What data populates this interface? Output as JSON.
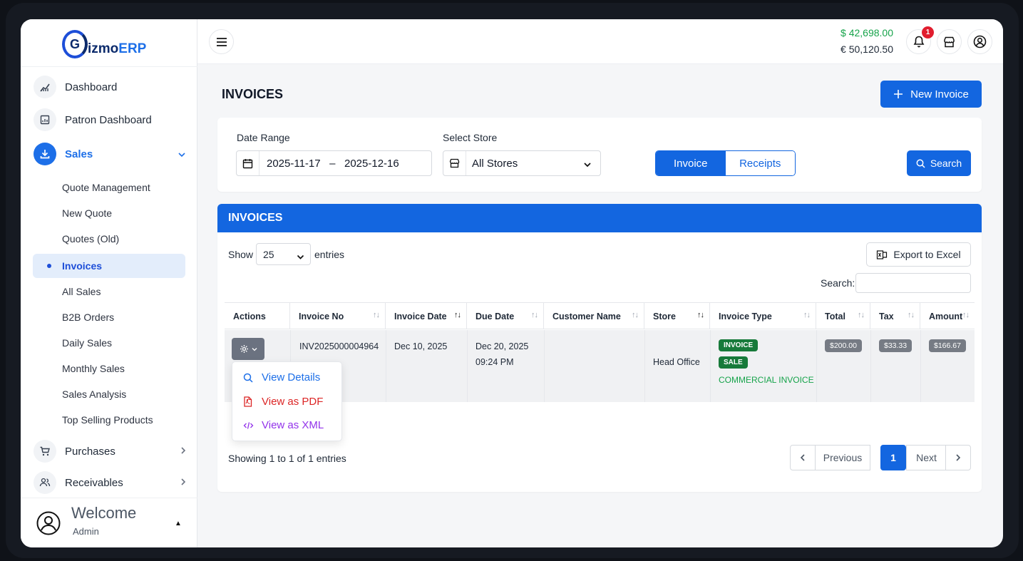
{
  "app": {
    "logo_prefix": "izmo",
    "logo_g": "G",
    "logo_suffix": "ERP"
  },
  "sidebar": {
    "main_items": [
      {
        "label": "Dashboard",
        "icon": "chart-icon"
      },
      {
        "label": "Patron Dashboard",
        "icon": "calculator-icon"
      },
      {
        "label": "Sales",
        "icon": "download-icon",
        "expanded": true
      },
      {
        "label": "Purchases",
        "icon": "cart-icon"
      },
      {
        "label": "Receivables",
        "icon": "users-icon"
      }
    ],
    "sales_sub": [
      "Quote Management",
      "New Quote",
      "Quotes (Old)",
      "Invoices",
      "All Sales",
      "B2B Orders",
      "Daily Sales",
      "Monthly Sales",
      "Sales Analysis",
      "Top Selling Products"
    ],
    "active_sub": "Invoices",
    "user": {
      "welcome": "Welcome",
      "role": "Admin"
    }
  },
  "topbar": {
    "balance_usd": "$ 42,698.00",
    "balance_eur": "€ 50,120.50",
    "notification_count": "1",
    "colors": {
      "usd": "#16a34a",
      "badge": "#e11d2e"
    }
  },
  "page": {
    "title": "INVOICES",
    "new_button": "New Invoice",
    "accent": "#1366e0"
  },
  "filters": {
    "date_label": "Date Range",
    "date_from": "2025-11-17",
    "date_sep": "–",
    "date_to": "2025-12-16",
    "store_label": "Select Store",
    "store_value": "All Stores",
    "toggle": [
      "Invoice",
      "Receipts"
    ],
    "toggle_active": "Invoice",
    "search_button": "Search"
  },
  "table": {
    "card_title": "INVOICES",
    "show_label": "Show",
    "entries_value": "25",
    "entries_label": "entries",
    "export_label": "Export to Excel",
    "search_label": "Search:",
    "columns": [
      "Actions",
      "Invoice No",
      "Invoice Date",
      "Due Date",
      "Customer Name",
      "Store",
      "Invoice Type",
      "Total",
      "Tax",
      "Amount"
    ],
    "rows": [
      {
        "invoice_no": "INV2025000004964",
        "invoice_date": "Dec 10, 2025",
        "due_date": "Dec 20, 2025",
        "due_time": "09:24 PM",
        "customer": "",
        "store": "Head Office",
        "type_badges": [
          "INVOICE",
          "SALE"
        ],
        "type_text": "COMMERCIAL INVOICE",
        "total": "$200.00",
        "tax": "$33.33",
        "amount": "$166.67"
      }
    ],
    "action_menu": [
      "View Details",
      "View as PDF",
      "View as XML"
    ],
    "action_colors": [
      "#1d6fe8",
      "#dc2626",
      "#9333ea"
    ],
    "showing": "Showing 1 to 1 of 1 entries",
    "pagination": {
      "prev": "Previous",
      "current": "1",
      "next": "Next"
    }
  }
}
